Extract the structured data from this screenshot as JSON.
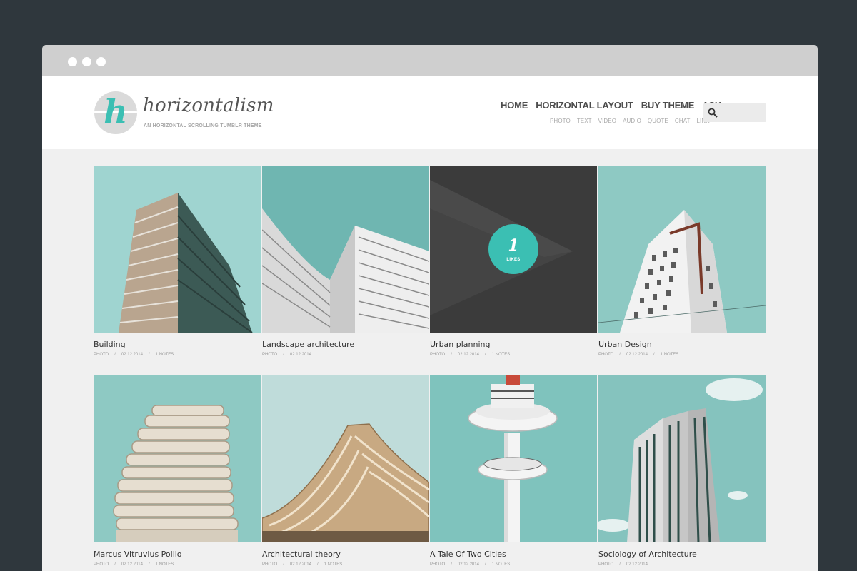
{
  "window": {
    "controls": [
      "close",
      "minimize",
      "maximize"
    ]
  },
  "site": {
    "logo_letter": "h",
    "title": "horizontalism",
    "tagline": "AN HORIZONTAL SCROLLING TUMBLR THEME"
  },
  "nav": {
    "items": [
      "HOME",
      "HORIZONTAL LAYOUT",
      "BUY THEME",
      "ASK"
    ],
    "subitems": [
      "PHOTO",
      "TEXT",
      "VIDEO",
      "AUDIO",
      "QUOTE",
      "CHAT",
      "LINK"
    ]
  },
  "search": {
    "placeholder": "",
    "icon": "search-icon"
  },
  "posts": [
    {
      "title": "Building",
      "type": "PHOTO",
      "date": "02.12.2014",
      "notes": "1 NOTES"
    },
    {
      "title": "Landscape architecture",
      "type": "PHOTO",
      "date": "02.12.2014"
    },
    {
      "title": "Urban planning",
      "type": "PHOTO",
      "date": "02.12.2014",
      "notes": "1 NOTES",
      "likes_count": "1",
      "likes_label": "LIKES"
    },
    {
      "title": "Urban Design",
      "type": "PHOTO",
      "date": "02.12.2014",
      "notes": "1 NOTES"
    },
    {
      "title": "Marcus Vitruvius Pollio",
      "type": "PHOTO",
      "date": "02.12.2014",
      "notes": "1 NOTES"
    },
    {
      "title": "Architectural theory",
      "type": "PHOTO",
      "date": "02.12.2014",
      "notes": "1 NOTES"
    },
    {
      "title": "A Tale Of Two Cities",
      "type": "PHOTO",
      "date": "02.12.2014",
      "notes": "1 NOTES"
    },
    {
      "title": "Sociology of Architecture",
      "type": "PHOTO",
      "date": "02.12.2014"
    }
  ],
  "colors": {
    "accent": "#3bbfb3",
    "sky": "#8ec9c3",
    "dark_tile": "#3b3b3b",
    "page_bg": "#2f373d"
  }
}
